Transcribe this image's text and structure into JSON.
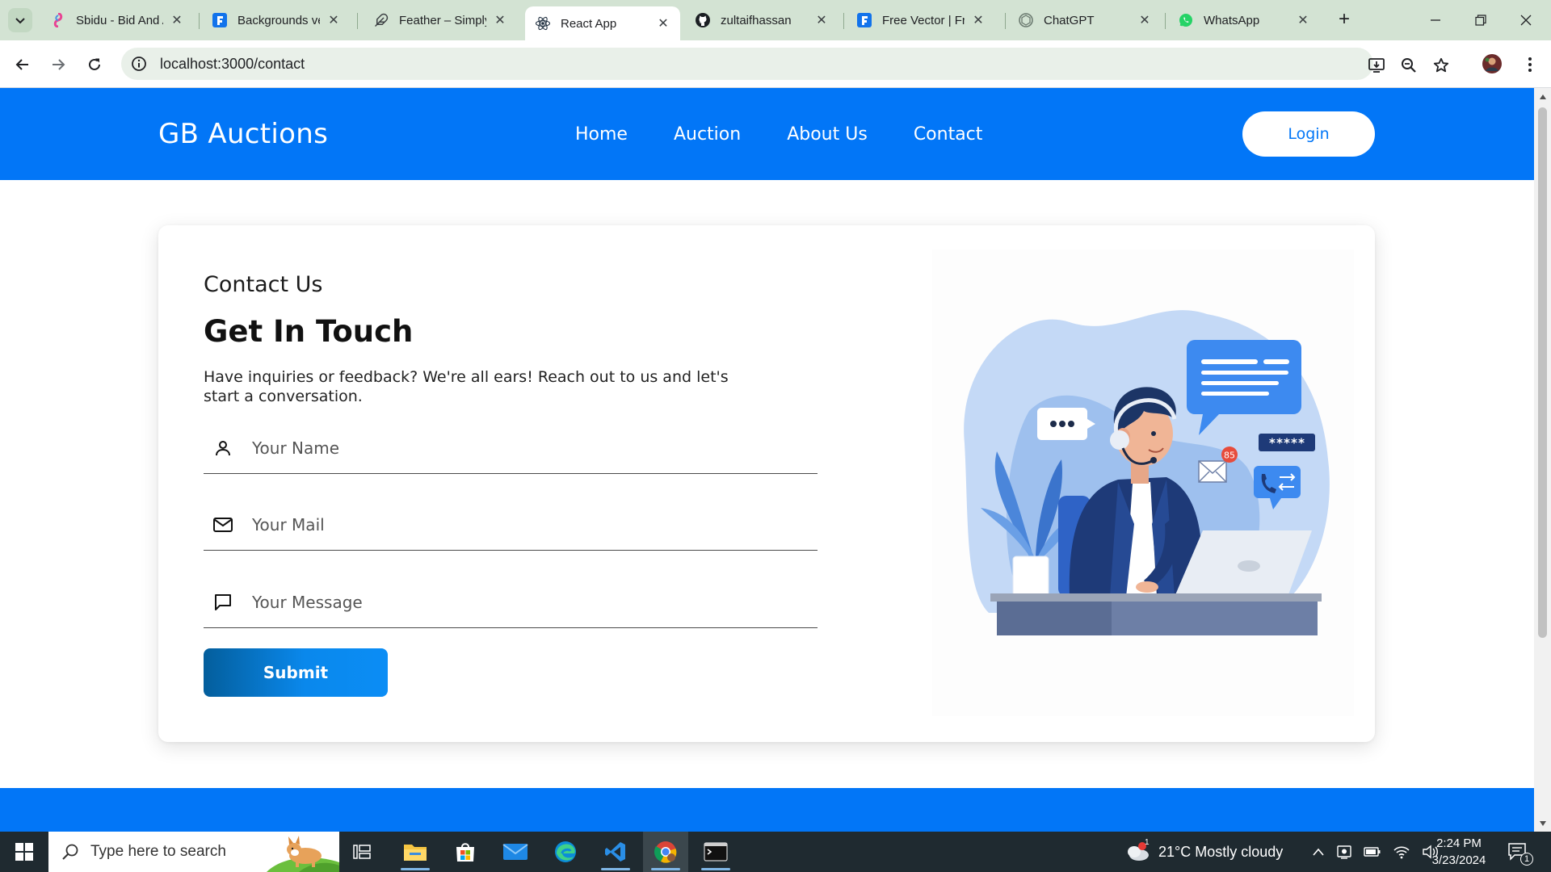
{
  "browser": {
    "tabs": [
      {
        "title": "Sbidu - Bid And Auction",
        "icon": "sbidu-icon"
      },
      {
        "title": "Backgrounds vectors",
        "icon": "freepik-icon"
      },
      {
        "title": "Feather – Simply beautiful",
        "icon": "feather-icon"
      },
      {
        "title": "React App",
        "icon": "react-icon",
        "active": true
      },
      {
        "title": "zultaifhassan",
        "icon": "github-icon"
      },
      {
        "title": "Free Vector | Free",
        "icon": "freepik-icon"
      },
      {
        "title": "ChatGPT",
        "icon": "chatgpt-icon"
      },
      {
        "title": "WhatsApp",
        "icon": "whatsapp-icon"
      }
    ],
    "url": "localhost:3000/contact"
  },
  "site": {
    "brand": "GB Auctions",
    "nav": [
      "Home",
      "Auction",
      "About Us",
      "Contact"
    ],
    "login": "Login"
  },
  "contact": {
    "eyebrow": "Contact Us",
    "heading": "Get In Touch",
    "lead": "Have inquiries or feedback? We're all ears! Reach out to us and let's start a conversation.",
    "name_placeholder": "Your Name",
    "mail_placeholder": "Your Mail",
    "message_placeholder": "Your Message",
    "submit": "Submit"
  },
  "illustration": {
    "badge_count": "85",
    "password_mask": "*****"
  },
  "taskbar": {
    "search_placeholder": "Type here to search",
    "weather": "21°C  Mostly cloudy",
    "weather_alert": "1",
    "time": "2:24 PM",
    "date": "3/23/2024",
    "notifications": "1"
  },
  "colors": {
    "brand_blue": "#0276f7",
    "tab_strip": "#d3e3d3"
  }
}
